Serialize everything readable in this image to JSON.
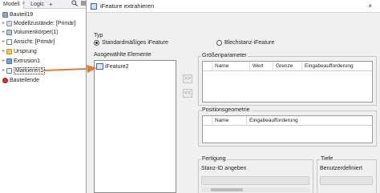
{
  "browser": {
    "tab_model": "Modell",
    "tab_model_close": "×",
    "tab_logic": "Logic",
    "tab_add": "+",
    "search_icon": "search-icon",
    "menu_icon": "menu-icon",
    "tree": [
      {
        "label": "Bauteil19",
        "expander": ""
      },
      {
        "label": "Modellzustände: [Primär]",
        "expander": "+"
      },
      {
        "label": "Volumenkörper(1)",
        "expander": "+"
      },
      {
        "label": "Ansicht: [Primär]",
        "expander": "+"
      },
      {
        "label": "Ursprung",
        "expander": "+"
      },
      {
        "label": "Extrusion1",
        "expander": "+"
      },
      {
        "label": "Markieren1",
        "expander": "+"
      },
      {
        "label": "Bauteilende",
        "expander": ""
      }
    ]
  },
  "dialog": {
    "title": "iFeature extrahieren",
    "close_glyph": "×",
    "typ_label": "Typ",
    "radio_standard": "Standardmäßiges iFeature",
    "radio_blechstanz": "Blechstanz-iFeature",
    "radio_selected": "standard",
    "selected_elements_label": "Ausgewählte Elemente",
    "selected_item": "iFeature2",
    "add_arrow": ">>",
    "remove_arrow": "<<",
    "size_params_label": "Größenparameter",
    "size_params_columns": [
      "Name",
      "Wert",
      "Grenze",
      "Eingabeaufforderung"
    ],
    "position_geom_label": "Positionsgeometrie",
    "position_geom_columns": [
      "Name",
      "Eingabeaufforderung"
    ],
    "fertigung_label": "Fertigung",
    "stanz_id_label": "Stanz-ID angeben",
    "tiefe_label": "Tiefe",
    "benutzerdefiniert_label": "Benutzerdefiniert"
  },
  "colors": {
    "callout_arrow": "#e07a3a"
  }
}
